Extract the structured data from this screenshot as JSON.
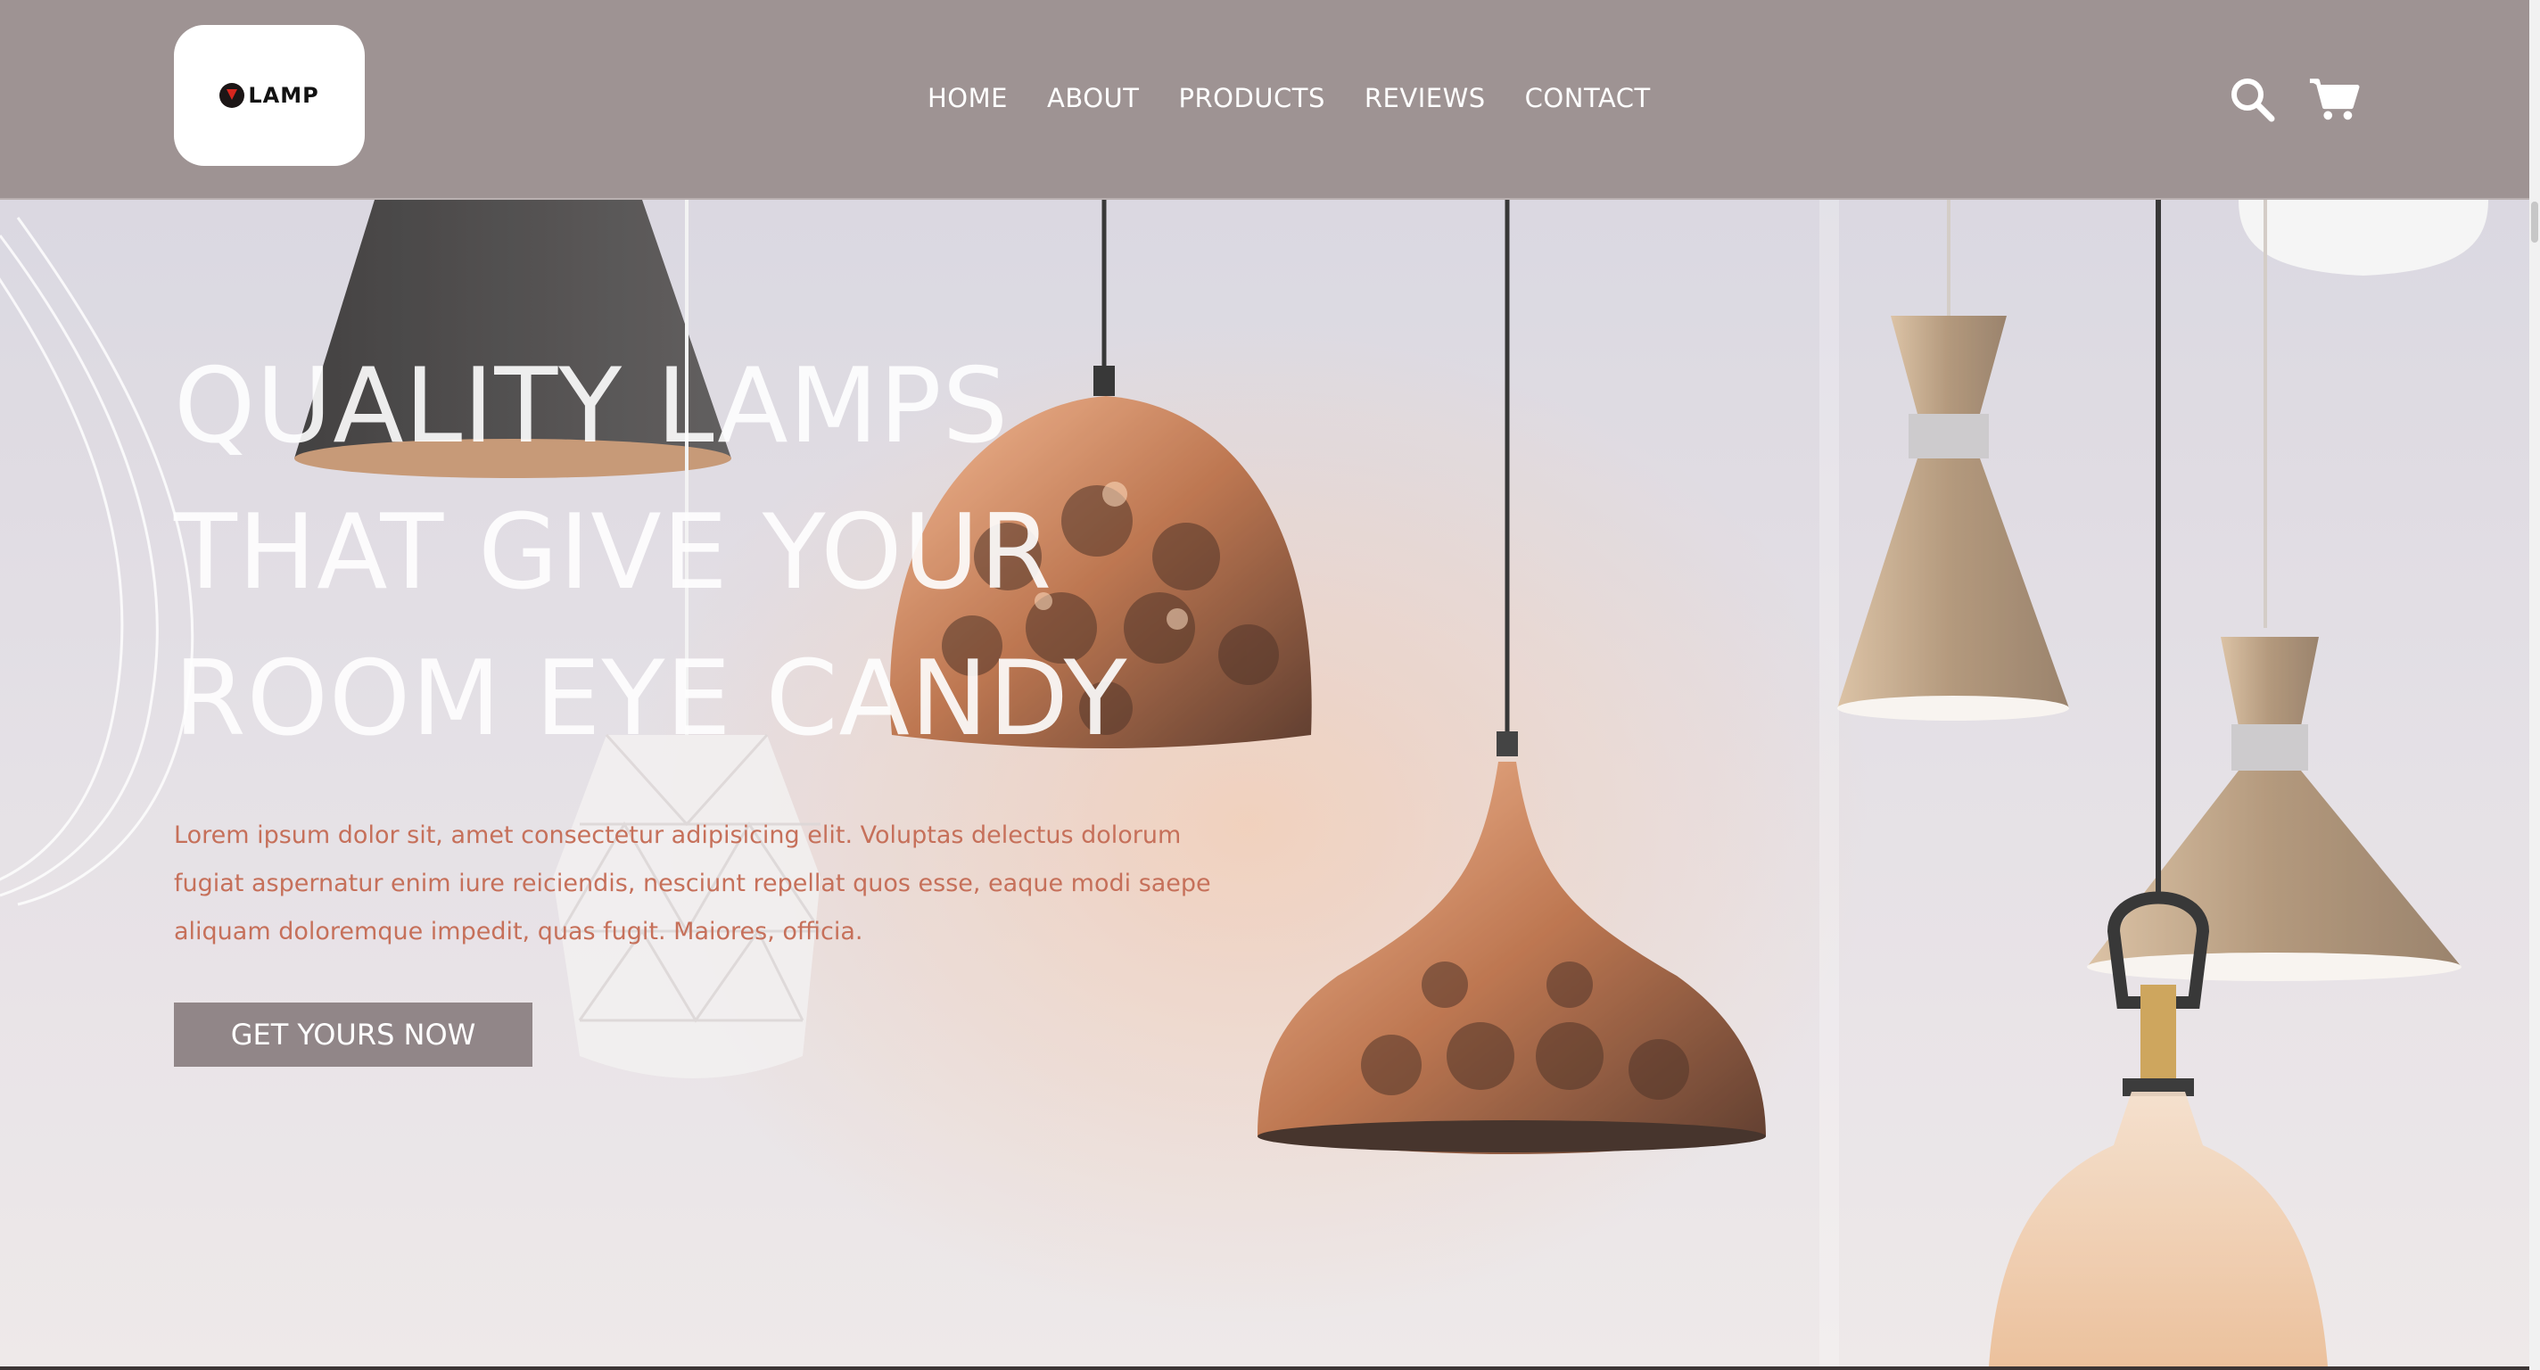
{
  "brand": {
    "logo_text": "LAMP"
  },
  "nav": {
    "items": [
      {
        "label": "HOME"
      },
      {
        "label": "ABOUT"
      },
      {
        "label": "PRODUCTS"
      },
      {
        "label": "REVIEWS"
      },
      {
        "label": "CONTACT"
      }
    ]
  },
  "header_icons": {
    "search": "search-icon",
    "cart": "cart-icon"
  },
  "hero": {
    "title_lines": [
      "QUALITY LAMPS",
      "THAT GIVE YOUR",
      "ROOM EYE CANDY"
    ],
    "description": "Lorem ipsum dolor sit, amet consectetur adipisicing elit. Voluptas delectus dolorum fugiat aspernatur enim iure reiciendis, nesciunt repellat quos esse, eaque modi saepe aliquam doloremque impedit, quas fugit. Maiores, officia.",
    "cta_label": "GET YOURS NOW"
  },
  "colors": {
    "header_bg": "#9e9393",
    "hero_text": "#ffffff",
    "description_text": "#c6705a",
    "cta_bg": "#918688"
  }
}
